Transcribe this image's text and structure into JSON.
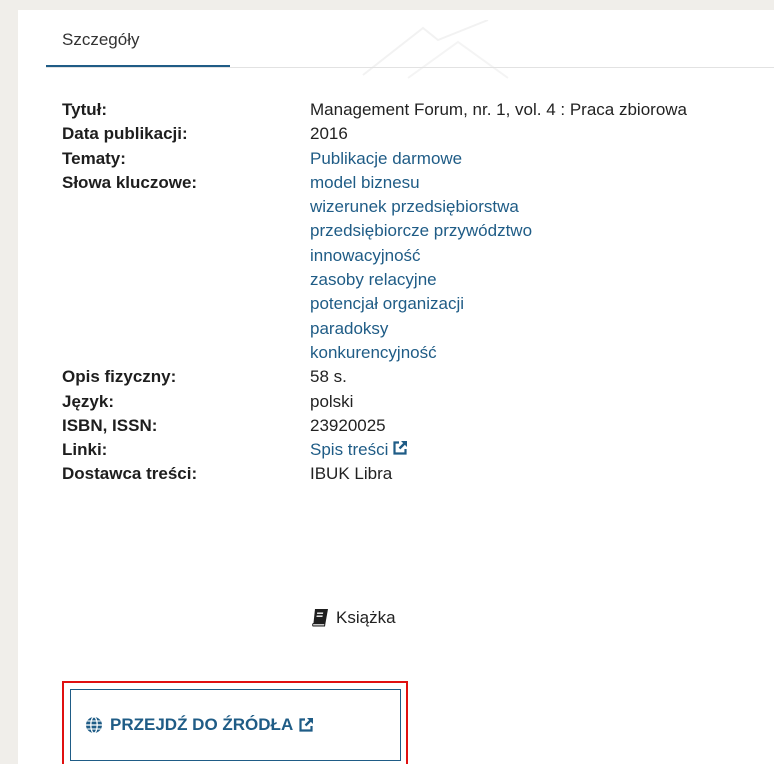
{
  "tabs": [
    {
      "label": "Szczegóły"
    }
  ],
  "details": {
    "title": {
      "label": "Tytuł:",
      "value": "Management Forum, nr. 1, vol. 4 : Praca zbiorowa"
    },
    "date": {
      "label": "Data publikacji:",
      "value": "2016"
    },
    "subjects": {
      "label": "Tematy:",
      "values": [
        "Publikacje darmowe"
      ]
    },
    "keywords": {
      "label": "Słowa kluczowe:",
      "values": [
        "model biznesu",
        "wizerunek przedsiębiorstwa",
        "przedsiębiorcze przywództwo",
        "innowacyjność",
        "zasoby relacyjne",
        "potencjał organizacji",
        "paradoksy",
        "konkurencyjność"
      ]
    },
    "physical": {
      "label": "Opis fizyczny:",
      "value": "58 s."
    },
    "language": {
      "label": "Język:",
      "value": "polski"
    },
    "isbn": {
      "label": "ISBN, ISSN:",
      "value": "23920025"
    },
    "links": {
      "label": "Linki:",
      "values": [
        "Spis treści"
      ]
    },
    "provider": {
      "label": "Dostawca treści:",
      "value": "IBUK Libra"
    }
  },
  "item_type": {
    "label": "Książka",
    "icon": "book-icon"
  },
  "source_button": {
    "label": "PRZEJDŹ DO ŹRÓDŁA",
    "icon": "globe-icon"
  },
  "colors": {
    "accent": "#1f5c86",
    "highlight": "#e01010",
    "page_bg": "#f0eeea"
  }
}
